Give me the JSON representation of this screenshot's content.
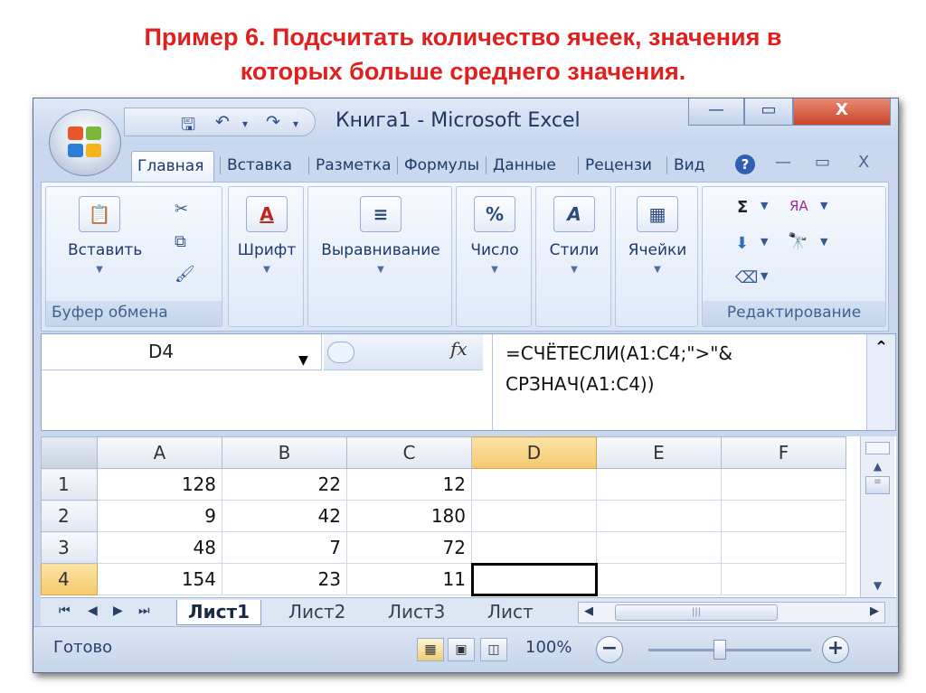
{
  "slide": {
    "title_line1": "Пример 6. Подсчитать количество ячеек, значения в",
    "title_line2": "которых больше среднего значения."
  },
  "window": {
    "title": "Книга1 - Microsoft Excel",
    "minimize": "—",
    "maximize": "▭",
    "close": "X"
  },
  "qat": {
    "save": "🖫",
    "undo": "↶",
    "redo": "↷",
    "menu": "▾"
  },
  "ribbon": {
    "tabs": [
      "Главная",
      "Вставка",
      "Разметка",
      "Формулы",
      "Данные",
      "Рецензи",
      "Вид"
    ],
    "help": "?",
    "groups": {
      "clipboard": {
        "button": "Вставить",
        "label": "Буфер обмена"
      },
      "font": {
        "button": "Шрифт",
        "icon": "A"
      },
      "alignment": {
        "button": "Выравнивание",
        "icon": "≡"
      },
      "number": {
        "button": "Число",
        "icon": "%"
      },
      "styles": {
        "button": "Стили",
        "icon": "A"
      },
      "cells": {
        "button": "Ячейки",
        "icon": "▦"
      },
      "editing": {
        "label": "Редактирование",
        "sum": "Σ",
        "sort": "ЯА",
        "find": "🔭"
      }
    }
  },
  "formula_bar": {
    "name_box": "D4",
    "fx": "fx",
    "formula_line1": "=СЧЁТЕСЛИ(A1:C4;\">\"&",
    "formula_line2": "СРЗНАЧ(A1:C4))"
  },
  "sheet": {
    "columns": [
      "A",
      "B",
      "C",
      "D",
      "E",
      "F"
    ],
    "rows": [
      {
        "num": "1",
        "cells": [
          "128",
          "22",
          "12",
          "",
          "",
          ""
        ]
      },
      {
        "num": "2",
        "cells": [
          "9",
          "42",
          "180",
          "",
          "",
          ""
        ]
      },
      {
        "num": "3",
        "cells": [
          "48",
          "7",
          "72",
          "",
          "",
          ""
        ]
      },
      {
        "num": "4",
        "cells": [
          "154",
          "23",
          "11",
          "",
          "",
          ""
        ]
      }
    ],
    "active_cell": "D4"
  },
  "sheet_tabs": [
    "Лист1",
    "Лист2",
    "Лист3",
    "Лист"
  ],
  "status": {
    "ready": "Готово",
    "zoom": "100%",
    "zoom_out": "−",
    "zoom_in": "+"
  }
}
